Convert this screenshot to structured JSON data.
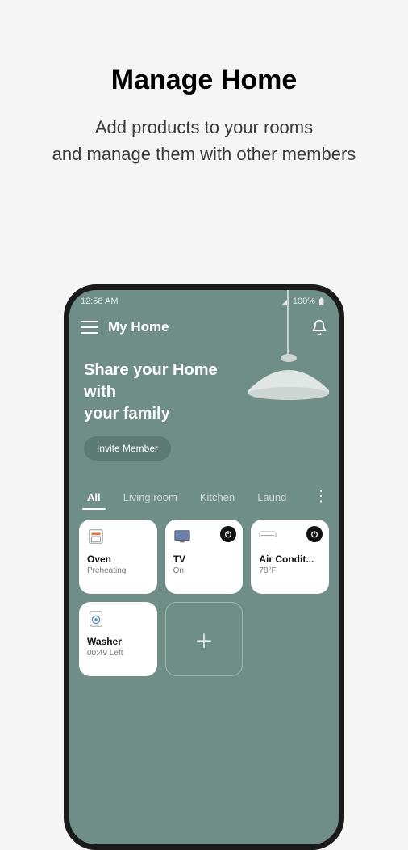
{
  "promo": {
    "title": "Manage Home",
    "sub_line1": "Add products to your rooms",
    "sub_line2": "and manage them with other members"
  },
  "statusbar": {
    "time": "12:58 AM",
    "battery": "100%"
  },
  "header": {
    "title": "My Home"
  },
  "hero": {
    "line1": "Share your Home with",
    "line2": "your family",
    "invite_label": "Invite Member"
  },
  "tabs": {
    "items": [
      {
        "label": "All",
        "active": true
      },
      {
        "label": "Living room",
        "active": false
      },
      {
        "label": "Kitchen",
        "active": false
      },
      {
        "label": "Laund",
        "active": false
      }
    ]
  },
  "devices": [
    {
      "name": "Oven",
      "status": "Preheating",
      "icon": "oven",
      "power": false
    },
    {
      "name": "TV",
      "status": "On",
      "icon": "tv",
      "power": true
    },
    {
      "name": "Air Condit...",
      "status": "78°F",
      "icon": "ac",
      "power": true
    },
    {
      "name": "Washer",
      "status": "00:49 Left",
      "icon": "washer",
      "power": false
    }
  ]
}
